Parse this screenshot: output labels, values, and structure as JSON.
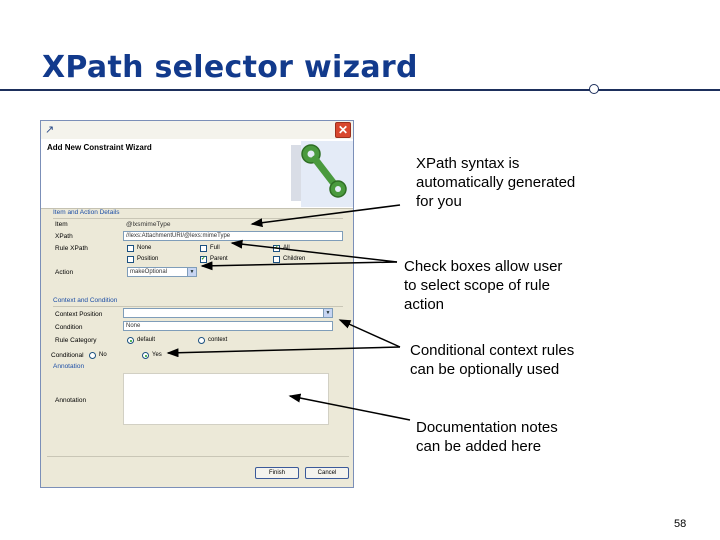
{
  "slide": {
    "title": "XPath selector wizard",
    "page_number": "58"
  },
  "dialog": {
    "title": "Add New Constraint Wizard",
    "close_glyph": "✕",
    "sections": {
      "item_action": "Item and Action Details",
      "context": "Context and Condition",
      "annotation": "Annotation"
    },
    "labels": {
      "item": "Item",
      "xpath": "XPath",
      "rule_xpath": "Rule XPath",
      "action": "Action",
      "context_position": "Context Position",
      "condition": "Condition",
      "rule_category": "Rule Category",
      "conditional": "Conditional",
      "annotation": "Annotation"
    },
    "values": {
      "item": "@lxsmimeType",
      "xpath": "//lexs:AttachmentURI/@lexs:mimeType",
      "action": "makeOptional",
      "context_position": "",
      "condition": "None"
    },
    "rule_xpath_options": [
      {
        "label": "None",
        "checked": false
      },
      {
        "label": "Full",
        "checked": false
      },
      {
        "label": "All",
        "checked": true
      },
      {
        "label": "Position",
        "checked": false
      },
      {
        "label": "Parent",
        "checked": true
      },
      {
        "label": "Children",
        "checked": false
      }
    ],
    "rule_category_options": [
      {
        "label": "default",
        "selected": true
      },
      {
        "label": "context",
        "selected": false
      }
    ],
    "conditional_options": [
      {
        "label": "No",
        "selected": false
      },
      {
        "label": "Yes",
        "selected": true
      }
    ],
    "buttons": {
      "finish": "Finish",
      "cancel": "Cancel"
    }
  },
  "callouts": {
    "xpath_syntax": [
      "XPath syntax is",
      "automatically generated",
      "for you"
    ],
    "check_boxes": [
      "Check boxes allow user",
      "to select scope of rule",
      "action"
    ],
    "conditional": [
      "Conditional context rules",
      "can be optionally used"
    ],
    "documentation": [
      "Documentation notes",
      "can be added here"
    ]
  },
  "colors": {
    "title": "#123a8c",
    "rule": "#1d2f5c",
    "dialog_bg": "#ece9d8",
    "section_text": "#1c4ea6",
    "close_button": "#d8472e"
  },
  "icons": {
    "banner": "wrench-icon",
    "close": "close-icon",
    "app": "wizard-app-icon"
  }
}
